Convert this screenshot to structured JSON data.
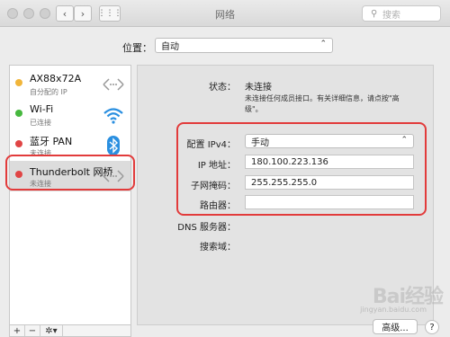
{
  "window": {
    "title": "网络"
  },
  "search": {
    "placeholder": "搜索"
  },
  "location": {
    "label": "位置：",
    "value": "自动"
  },
  "services": [
    {
      "name": "AX88x72A",
      "status": "自分配的 IP",
      "dot_color": "#f1b53a",
      "icon": "ethernet-icon"
    },
    {
      "name": "Wi-Fi",
      "status": "已连接",
      "dot_color": "#47b83f",
      "icon": "wifi-icon"
    },
    {
      "name": "蓝牙 PAN",
      "status": "未连接",
      "dot_color": "#e04545",
      "icon": "bluetooth-icon"
    },
    {
      "name": "Thunderbolt 网桥",
      "status": "未连接",
      "dot_color": "#e04545",
      "icon": "ethernet-icon"
    }
  ],
  "sidebar_buttons": {
    "add": "+",
    "remove": "−",
    "gear": "✲▾"
  },
  "detail": {
    "status_label": "状态：",
    "status_value": "未连接",
    "status_desc_1": "未连接任何成员接口。有关详细信息，请点按\"高",
    "status_desc_2": "级\"。",
    "ipv4_label": "配置 IPv4：",
    "ipv4_value": "手动",
    "ip_label": "IP 地址：",
    "ip_value": "180.100.223.136",
    "mask_label": "子网掩码：",
    "mask_value": "255.255.255.0",
    "router_label": "路由器：",
    "router_value": "",
    "dns_label": "DNS 服务器：",
    "search_domain_label": "搜索域："
  },
  "buttons": {
    "advanced": "高级...",
    "help": "?"
  },
  "watermark": {
    "text": "Bai经验",
    "sub": "jingyan.baidu.com"
  },
  "colors": {
    "highlight": "#e23b3b"
  }
}
